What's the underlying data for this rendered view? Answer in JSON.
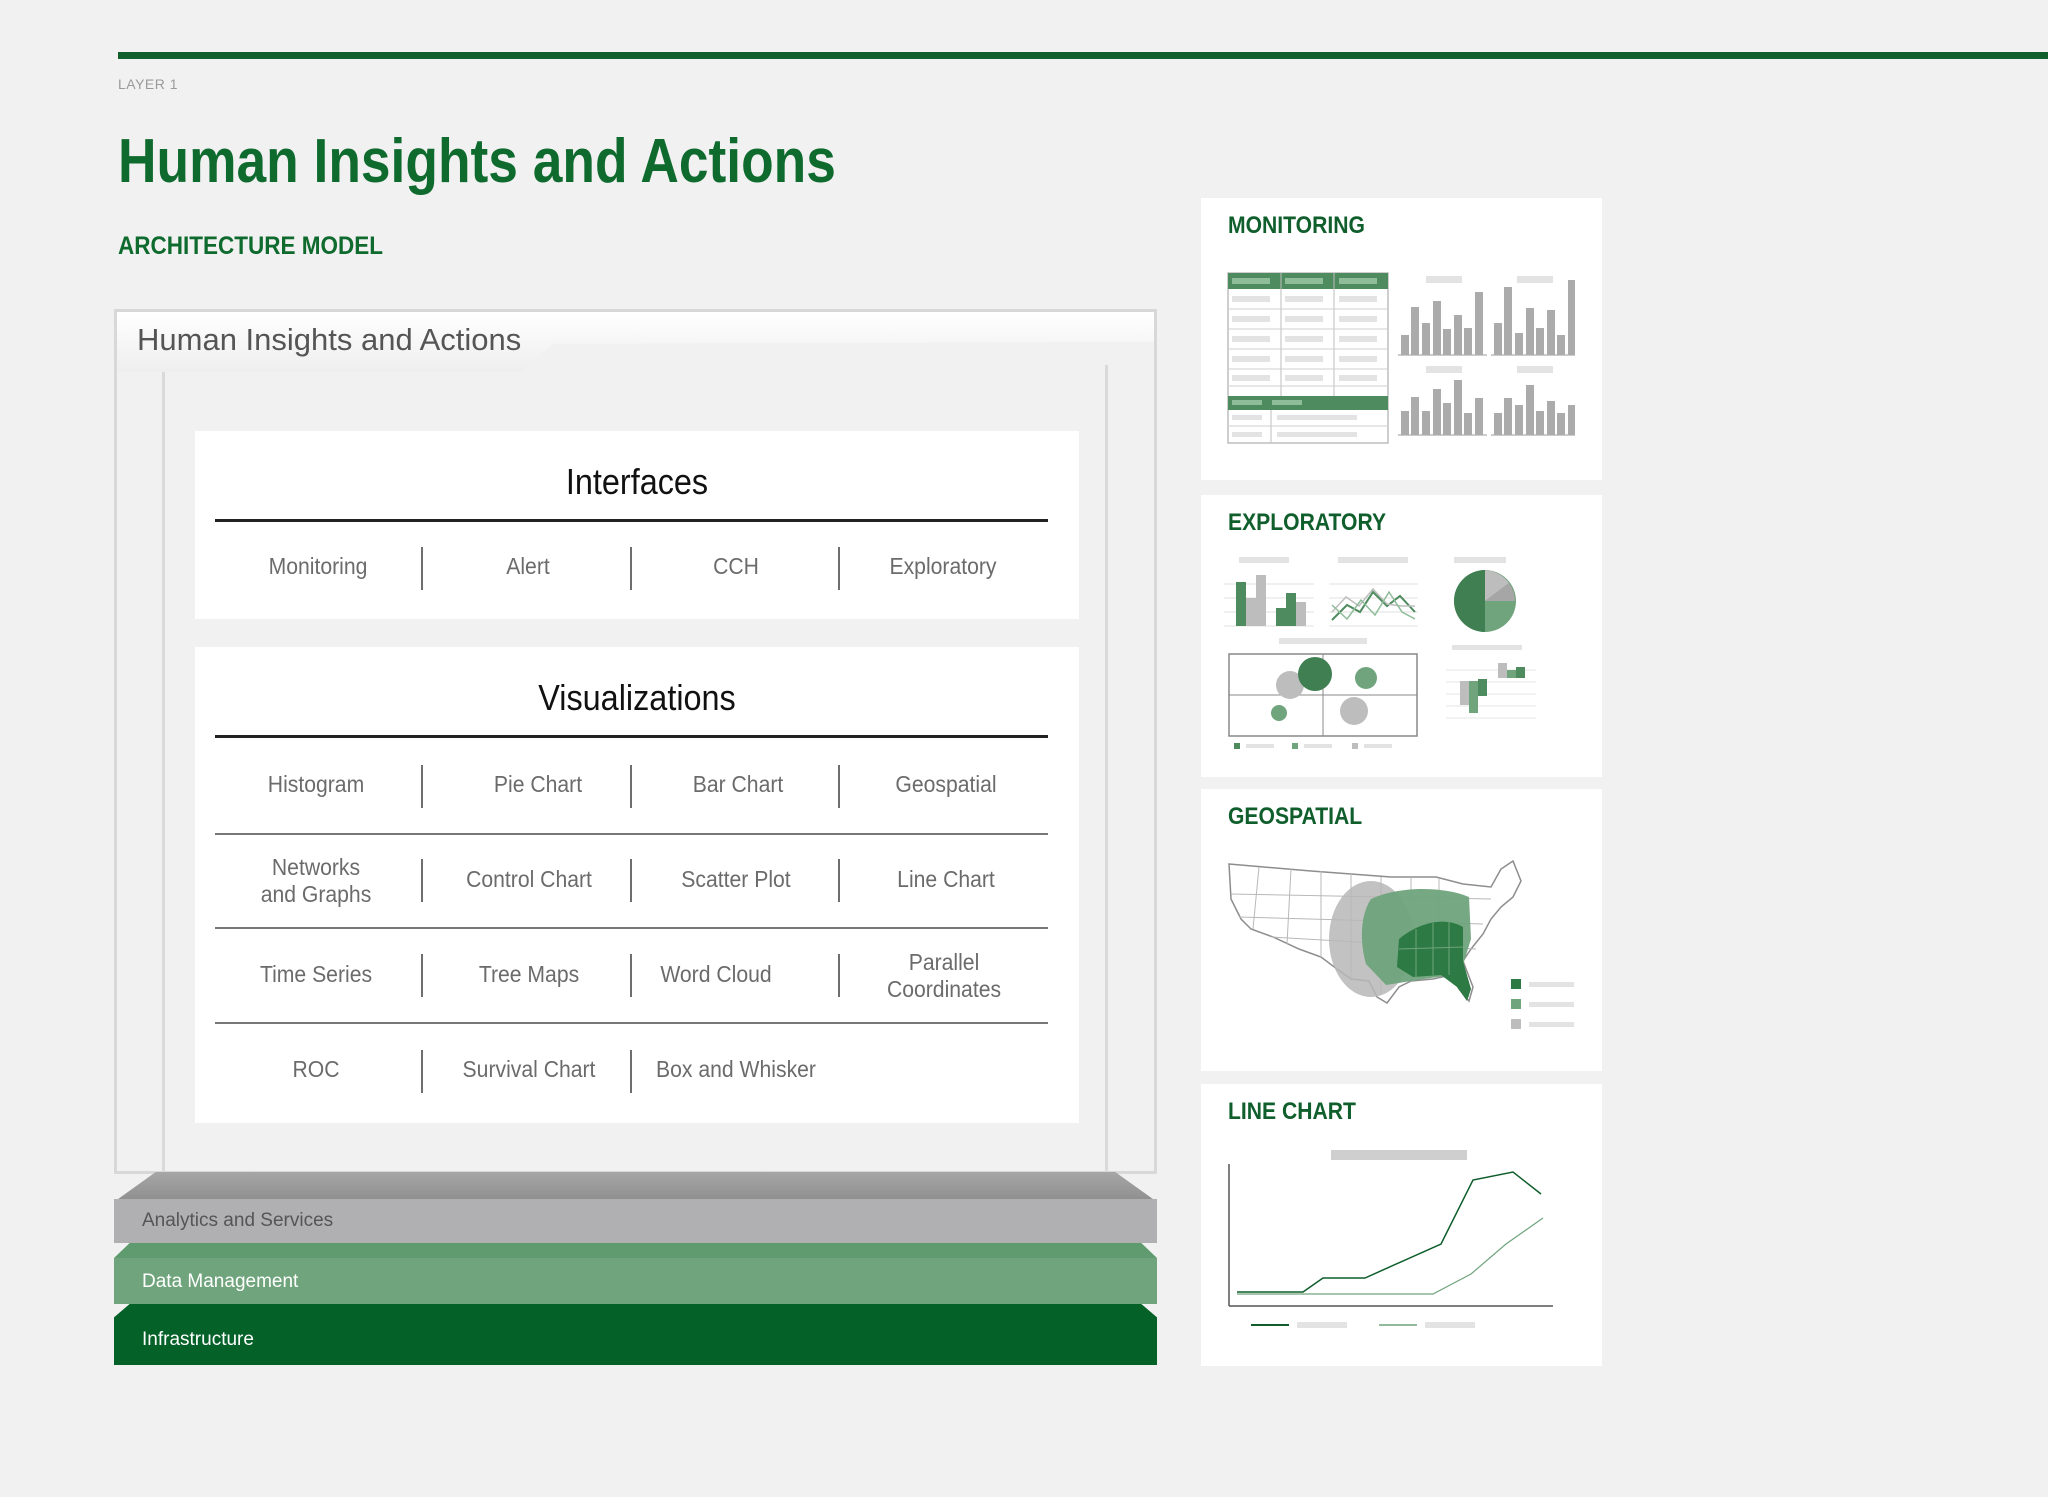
{
  "header": {
    "layer": "LAYER 1",
    "title": "Human Insights and Actions",
    "subtitle": "ARCHITECTURE MODEL"
  },
  "architecture": {
    "tab_label": "Human Insights and Actions",
    "interfaces": {
      "title": "Interfaces",
      "items": [
        "Monitoring",
        "Alert",
        "CCH",
        "Exploratory"
      ]
    },
    "visualizations": {
      "title": "Visualizations",
      "rows": [
        [
          "Histogram",
          "Pie Chart",
          "Bar Chart",
          "Geospatial"
        ],
        [
          "Networks\nand Graphs",
          "Control Chart",
          "Scatter Plot",
          "Line Chart"
        ],
        [
          "Time Series",
          "Tree Maps",
          "Word Cloud",
          "Parallel\nCoordinates"
        ],
        [
          "ROC",
          "Survival Chart",
          "Box and Whisker"
        ]
      ]
    },
    "layers": {
      "analytics": "Analytics and Services",
      "data": "Data Management",
      "infrastructure": "Infrastructure"
    }
  },
  "cards": {
    "monitoring": "MONITORING",
    "exploratory": "EXPLORATORY",
    "geospatial": "GEOSPATIAL",
    "line_chart": "LINE CHART"
  },
  "colors": {
    "brand_green": "#0f5e2c",
    "mid_green": "#4e8b5e",
    "light_green": "#6fa47c",
    "gray": "#b0b0b2"
  }
}
